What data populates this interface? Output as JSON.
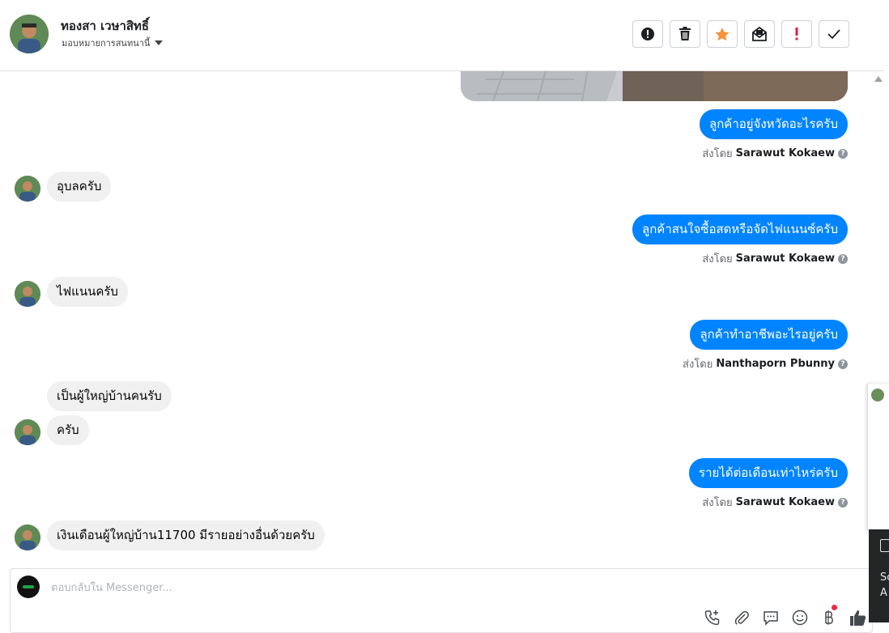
{
  "header": {
    "contact_name": "ทองสา เวษาสิทธิ์",
    "assign_label": "มอบหมายการสนทนานี้",
    "actions": [
      "alert-icon",
      "trash-icon",
      "star-icon",
      "unread-mail-icon",
      "important-icon",
      "check-icon"
    ]
  },
  "colors": {
    "outgoing": "#0084ff",
    "incoming": "#f0f0f0",
    "star": "#f7923b",
    "important": "#e41e3f"
  },
  "messages": [
    {
      "dir": "out",
      "text": "ลูกค้าอยู่จังหวัดอะไรครับ",
      "sent_prefix": "ส่งโดย",
      "sender": "Sarawut Kokaew"
    },
    {
      "dir": "in",
      "text": "อุบลครับ"
    },
    {
      "dir": "out",
      "text": "ลูกค้าสนใจซื้อสดหรือจัดไฟแนนซ์ครับ",
      "sent_prefix": "ส่งโดย",
      "sender": "Sarawut Kokaew"
    },
    {
      "dir": "in",
      "text": "ไฟแนนครับ"
    },
    {
      "dir": "out",
      "text": "ลูกค้าทำอาชีพอะไรอยู่ครับ",
      "sent_prefix": "ส่งโดย",
      "sender": "Nanthaporn Pbunny"
    },
    {
      "dir": "in",
      "text": "เป็นผู้ใหญ่บ้านคนรับ"
    },
    {
      "dir": "in",
      "text": "ครับ"
    },
    {
      "dir": "out",
      "text": "รายได้ต่อเดือนเท่าไหร่ครับ",
      "sent_prefix": "ส่งโดย",
      "sender": "Sarawut Kokaew"
    },
    {
      "dir": "in",
      "text": "เงินเดือนผู้ใหญ่บ้าน11700  มีรายอย่างอื่นด้วยครับ"
    }
  ],
  "composer": {
    "placeholder": "ตอบกลับใน Messenger...",
    "tools": [
      "add-call-icon",
      "attachment-icon",
      "saved-reply-icon",
      "emoji-icon",
      "payment-icon",
      "like-icon"
    ]
  },
  "side_panel": {
    "text_line1": "Sc",
    "text_line2": "A"
  }
}
